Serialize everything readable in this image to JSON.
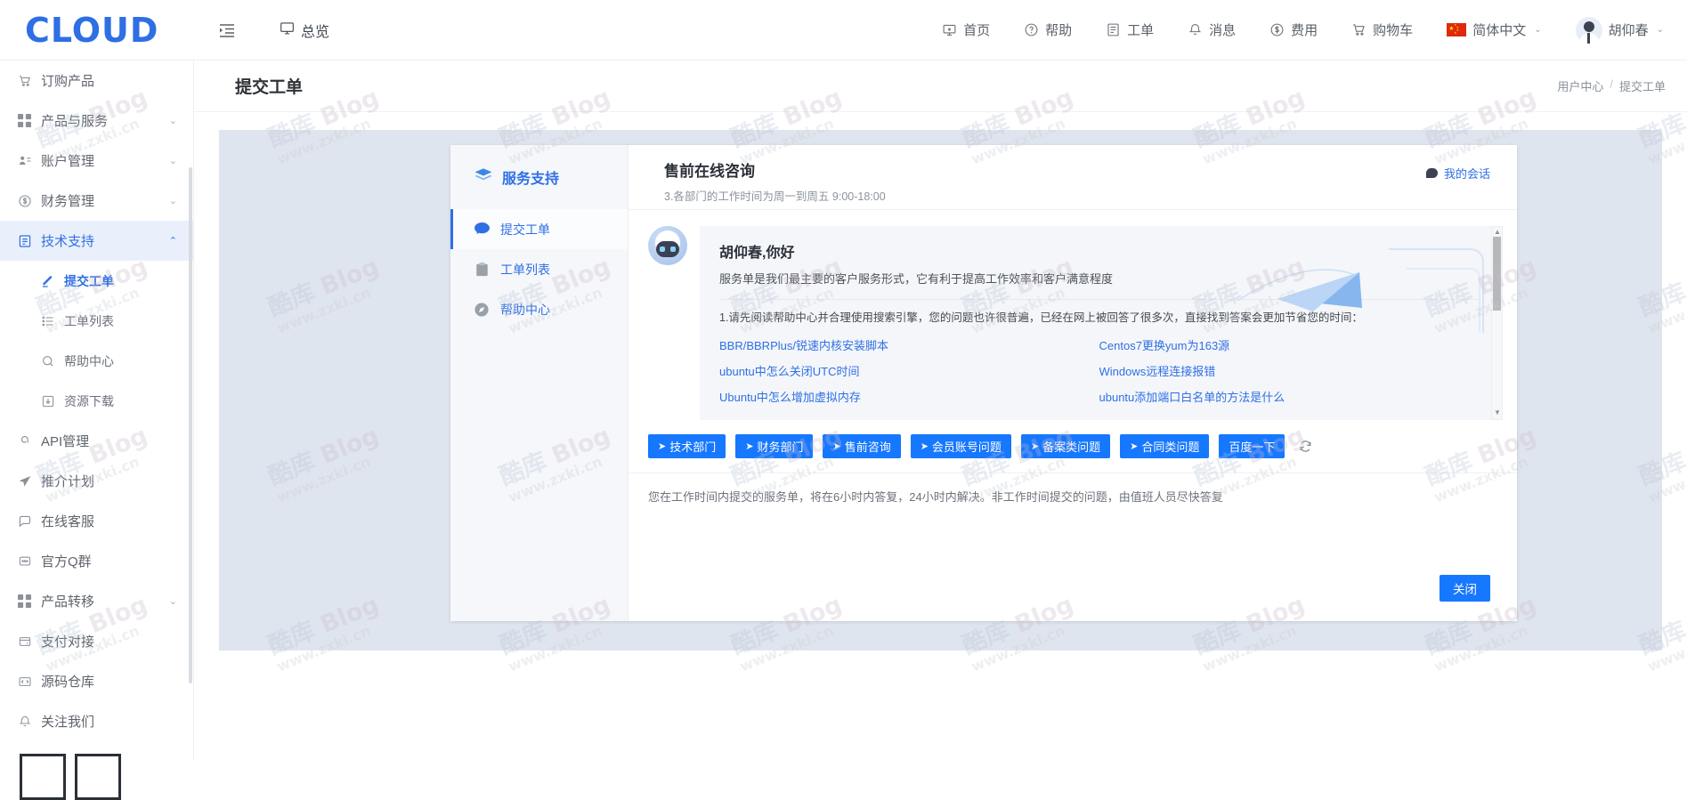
{
  "brand": {
    "logo": "CLOUD"
  },
  "topbar": {
    "collapse_icon": "menu-collapse-icon",
    "overview_label": "总览",
    "overview_icon": "monitor-icon",
    "nav": [
      {
        "label": "首页",
        "icon": "home-screen-icon"
      },
      {
        "label": "帮助",
        "icon": "question-circle-icon"
      },
      {
        "label": "工单",
        "icon": "ticket-document-icon"
      },
      {
        "label": "消息",
        "icon": "bell-icon"
      },
      {
        "label": "费用",
        "icon": "dollar-circle-icon"
      },
      {
        "label": "购物车",
        "icon": "cart-icon"
      }
    ],
    "language": {
      "label": "简体中文",
      "icon": "china-flag-icon",
      "caret": "⌄"
    },
    "user": {
      "name": "胡仰春",
      "icon": "avatar",
      "caret": "⌄"
    }
  },
  "sidebar": {
    "items": [
      {
        "label": "订购产品",
        "icon": "cart-icon",
        "expandable": false,
        "active": false
      },
      {
        "label": "产品与服务",
        "icon": "grid-icon",
        "expandable": true,
        "chevron": "⌄",
        "active": false
      },
      {
        "label": "账户管理",
        "icon": "user-list-icon",
        "expandable": true,
        "chevron": "⌄",
        "active": false
      },
      {
        "label": "财务管理",
        "icon": "dollar-circle-icon",
        "expandable": true,
        "chevron": "⌄",
        "active": false
      },
      {
        "label": "技术支持",
        "icon": "document-icon",
        "expandable": true,
        "chevron": "⌃",
        "active": true
      }
    ],
    "sub_items": [
      {
        "label": "提交工单",
        "icon": "pencil-icon",
        "selected": true
      },
      {
        "label": "工单列表",
        "icon": "list-icon",
        "selected": false
      },
      {
        "label": "帮助中心",
        "icon": "search-icon",
        "selected": false
      },
      {
        "label": "资源下载",
        "icon": "download-box-icon",
        "selected": false
      }
    ],
    "items_after": [
      {
        "label": "API管理",
        "icon": "link-icon",
        "expandable": false
      },
      {
        "label": "推介计划",
        "icon": "paper-plane-icon",
        "expandable": false
      },
      {
        "label": "在线客服",
        "icon": "chat-bubble-icon",
        "expandable": false
      },
      {
        "label": "官方Q群",
        "icon": "message-dots-icon",
        "expandable": false
      },
      {
        "label": "产品转移",
        "icon": "grid-icon",
        "expandable": true,
        "chevron": "⌄"
      },
      {
        "label": "支付对接",
        "icon": "wallet-icon",
        "expandable": false
      },
      {
        "label": "源码仓库",
        "icon": "code-icon",
        "expandable": false
      },
      {
        "label": "关注我们",
        "icon": "bell-icon",
        "expandable": false
      }
    ]
  },
  "page": {
    "title": "提交工单",
    "breadcrumb": [
      "用户中心",
      "提交工单"
    ],
    "breadcrumb_sep": "/"
  },
  "dialog": {
    "left_menu": {
      "brand_label": "服务支持",
      "brand_icon": "support-layers-icon",
      "items": [
        {
          "label": "提交工单",
          "icon": "chat-bubble-filled-icon",
          "selected": true
        },
        {
          "label": "工单列表",
          "icon": "clipboard-icon",
          "selected": false
        },
        {
          "label": "帮助中心",
          "icon": "compass-icon",
          "selected": false
        }
      ]
    },
    "header": {
      "title": "售前在线咨询",
      "subtitle": "3.各部门的工作时间为周一到周五 9:00-18:00",
      "my_session_label": "我的会话",
      "my_session_icon": "chat-bubble-icon"
    },
    "message": {
      "avatar_icon": "robot-avatar-icon",
      "greeting": "胡仰春,你好",
      "greeting_sub": "服务单是我们最主要的客户服务形式，它有利于提高工作效率和客户满意程度",
      "note": "1.请先阅读帮助中心并合理使用搜索引擎，您的问题也许很普遍，已经在网上被回答了很多次，直接找到答案会更加节省您的时间：",
      "links": [
        "BBR/BBRPlus/锐速内核安装脚本",
        "Centos7更换yum为163源",
        "ubuntu中怎么关闭UTC时间",
        "Windows远程连接报错",
        "Ubuntu中怎么增加虚拟内存",
        "ubuntu添加端口白名单的方法是什么"
      ],
      "decoration_icon": "paper-plane-illustration"
    },
    "quick_buttons": [
      {
        "label": "技术部门",
        "icon": "send-icon"
      },
      {
        "label": "财务部门",
        "icon": "send-icon"
      },
      {
        "label": "售前咨询",
        "icon": "send-icon"
      },
      {
        "label": "会员账号问题",
        "icon": "send-icon"
      },
      {
        "label": "备案类问题",
        "icon": "send-icon"
      },
      {
        "label": "合同类问题",
        "icon": "send-icon"
      },
      {
        "label": "百度一下",
        "icon": null
      }
    ],
    "refresh_icon": "refresh-icon",
    "footer_note": "您在工作时间内提交的服务单，将在6小时内答复，24小时内解决。非工作时间提交的问题，由值班人员尽快答复",
    "close_label": "关闭"
  },
  "watermark": {
    "line1_a": "酷库 ",
    "line1_b": "Blog",
    "line2": "www.zxki.cn"
  },
  "colors": {
    "accent": "#1677ff",
    "brand": "#2f6fe4",
    "panel_bg": "#dfe5ee",
    "bubble_bg": "#f4f6f9",
    "sidebar_active_bg": "#eaf0fb",
    "flag_red": "#de2910"
  }
}
